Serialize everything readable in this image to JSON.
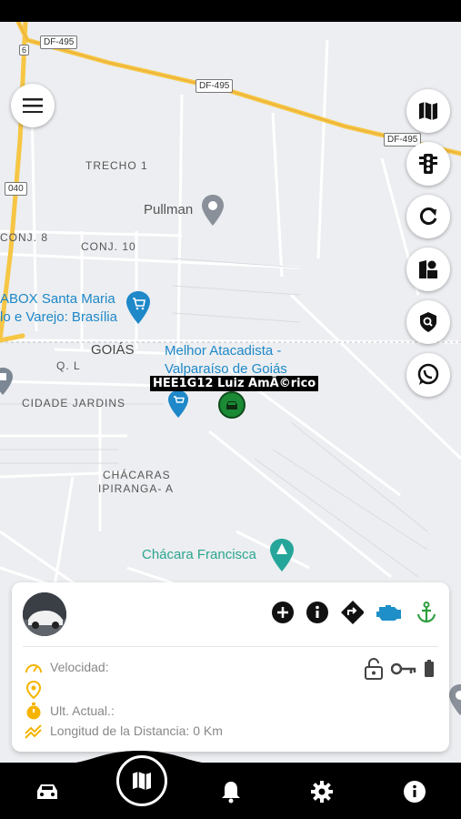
{
  "map": {
    "roads": {
      "df495_a": "DF-495",
      "df495_b": "DF-495",
      "df495_c": "DF-495",
      "route_040": "040",
      "route_6": "6"
    },
    "areas": {
      "trecho1": "TRECHO 1",
      "conj8": "CONJ. 8",
      "conj10": "CONJ. 10",
      "goias": "GOIÁS",
      "ql": "Q. L",
      "cidade_jardins": "CIDADE JARDINS",
      "chacaras_line1": "CHÁCARAS",
      "chacaras_line2": "IPIRANGA- A"
    },
    "pois": {
      "pullman": "Pullman",
      "abox_line1": "ABOX Santa Maria",
      "abox_line2": "lo e Varejo: Brasília",
      "atacadista_line1": "Melhor Atacadista -",
      "atacadista_line2": "Valparaíso de Goiás",
      "chacara_francisca": "Chácara Francisca"
    },
    "vehicle_label": "HEE1G12 Luiz AmÃ©rico"
  },
  "fabs": [
    {
      "name": "map-layers-button",
      "icon": "map-icon"
    },
    {
      "name": "traffic-button",
      "icon": "traffic-light-icon"
    },
    {
      "name": "refresh-button",
      "icon": "refresh-icon"
    },
    {
      "name": "geofence-button",
      "icon": "geofence-icon"
    },
    {
      "name": "security-button",
      "icon": "shield-search-icon"
    },
    {
      "name": "whatsapp-button",
      "icon": "whatsapp-icon"
    }
  ],
  "card": {
    "speed_label": "Velocidad:",
    "location_label": "",
    "last_update_label": "Ult. Actual.:",
    "distance_label": "Longitud de la Distancia: 0 Km",
    "colors": {
      "accent": "#f5b400",
      "engine": "#1e8fc8",
      "anchor": "#2e9e3f"
    }
  },
  "nav": {
    "items": [
      "car-icon",
      "map-icon",
      "bell-icon",
      "gear-icon",
      "info-icon"
    ]
  }
}
